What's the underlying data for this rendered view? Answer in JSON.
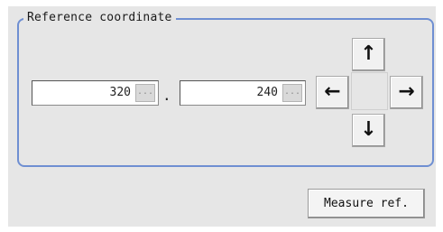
{
  "group": {
    "title": "Reference coordinate"
  },
  "coords": {
    "x": {
      "value": "320",
      "browse": "..."
    },
    "separator": ".",
    "y": {
      "value": "240",
      "browse": "..."
    }
  },
  "arrows": {
    "up": "↑",
    "left": "←",
    "right": "→",
    "down": "↓"
  },
  "buttons": {
    "measure_ref": "Measure ref."
  }
}
